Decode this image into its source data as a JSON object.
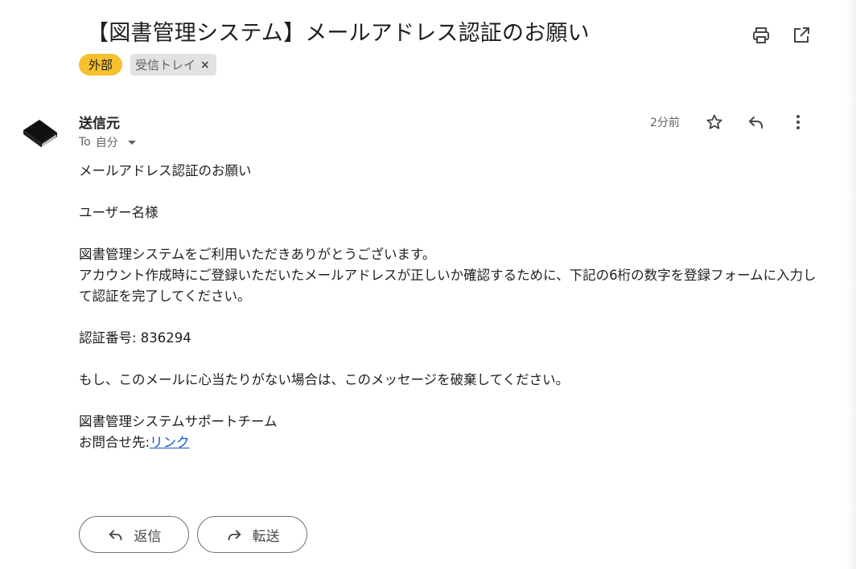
{
  "email": {
    "subject": "【図書管理システム】メールアドレス認証のお願い",
    "labels": {
      "external": "外部",
      "inbox": "受信トレイ",
      "inbox_remove": "×"
    },
    "sender": {
      "name": "送信元",
      "to_prefix": "To",
      "to_value": "自分",
      "time": "2分前"
    },
    "body": {
      "line1": "メールアドレス認証のお願い",
      "line2": "ユーザー名様",
      "line3a": "図書管理システムをご利用いただきありがとうございます。",
      "line3b": "アカウント作成時にご登録いただいたメールアドレスが正しいか確認するために、下記の6桁の数字を登録フォームに入力して認証を完了してください。",
      "line4": "認証番号: 836294",
      "line5": "もし、このメールに心当たりがない場合は、このメッセージを破棄してください。",
      "line6a": "図書管理システムサポートチーム",
      "contact_prefix": "お問合せ先:",
      "contact_link": "リンク"
    }
  },
  "buttons": {
    "reply": "返信",
    "forward": "転送"
  },
  "icons": {
    "print": "print-icon",
    "open_new_window": "open-in-new-icon",
    "star": "star-icon",
    "reply": "reply-icon",
    "more": "more-vert-icon",
    "avatar": "book-icon"
  },
  "colors": {
    "label_external_bg": "#f6c02e",
    "label_inbox_bg": "#e2e2e2",
    "link": "#1a55c8"
  }
}
